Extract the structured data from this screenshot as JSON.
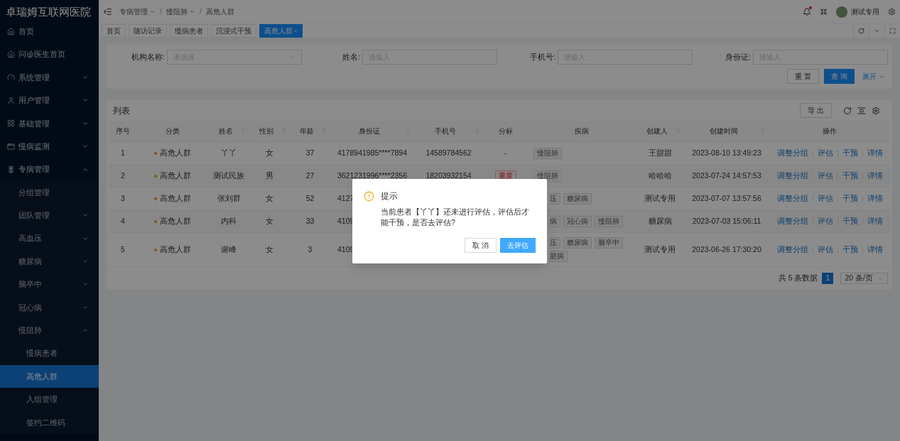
{
  "sidebar": {
    "title": "卓瑞姆互联网医院",
    "items": [
      {
        "label": "首页",
        "selected": false
      },
      {
        "label": "问诊医生首页",
        "selected": false
      },
      {
        "label": "系统管理",
        "selected": false,
        "expanded": false
      },
      {
        "label": "用户管理",
        "selected": false,
        "expanded": false
      },
      {
        "label": "基础管理",
        "selected": false,
        "expanded": false
      },
      {
        "label": "慢病监测",
        "selected": false,
        "expanded": false
      },
      {
        "label": "专病管理",
        "selected": false,
        "expanded": true,
        "children": [
          {
            "label": "分组管理",
            "selected": false
          },
          {
            "label": "团队管理",
            "selected": false,
            "expanded": false
          },
          {
            "label": "高血压",
            "selected": false,
            "expanded": false
          },
          {
            "label": "糖尿病",
            "selected": false,
            "expanded": false
          },
          {
            "label": "脑卒中",
            "selected": false,
            "expanded": false
          },
          {
            "label": "冠心病",
            "selected": false,
            "expanded": false
          },
          {
            "label": "慢阻肺",
            "selected": false,
            "expanded": true,
            "children": [
              {
                "label": "慢病患者",
                "selected": false
              },
              {
                "label": "高危人群",
                "selected": true
              },
              {
                "label": "入组管理",
                "selected": false
              },
              {
                "label": "签约二维码",
                "selected": false
              }
            ]
          }
        ]
      }
    ]
  },
  "header": {
    "breadcrumbs": [
      {
        "label": "专病管理",
        "dropdown": true
      },
      {
        "label": "慢阻肺",
        "dropdown": true
      },
      {
        "label": "高危人群",
        "dropdown": false
      }
    ],
    "separator": "/",
    "notification_dot": true,
    "user": "测试专用"
  },
  "tabs": [
    {
      "label": "首页",
      "selected": false,
      "closable": false
    },
    {
      "label": "随访记录",
      "selected": false,
      "closable": false
    },
    {
      "label": "慢病患者",
      "selected": false,
      "closable": false
    },
    {
      "label": "沉浸式干预",
      "selected": false,
      "closable": false
    },
    {
      "label": "高危人群",
      "selected": true,
      "closable": true
    }
  ],
  "filter": {
    "fields": [
      {
        "label": "机构名称:",
        "placeholder": "请选择",
        "kind": "select"
      },
      {
        "label": "姓名:",
        "placeholder": "请输入",
        "kind": "input"
      },
      {
        "label": "手机号:",
        "placeholder": "请输入",
        "kind": "input"
      },
      {
        "label": "身份证:",
        "placeholder": "请输入",
        "kind": "input"
      }
    ],
    "reset": "重 置",
    "search": "查 询",
    "expand": "展开"
  },
  "list": {
    "title": "列表",
    "export": "导 出",
    "columns": [
      {
        "label": "序号",
        "sortable": false
      },
      {
        "label": "分类",
        "sortable": false
      },
      {
        "label": "姓名",
        "sortable": true
      },
      {
        "label": "性别",
        "sortable": true
      },
      {
        "label": "年龄",
        "sortable": true
      },
      {
        "label": "身份证",
        "sortable": true
      },
      {
        "label": "手机号",
        "sortable": true
      },
      {
        "label": "分标",
        "sortable": false
      },
      {
        "label": "疾病",
        "sortable": false
      },
      {
        "label": "创建人",
        "sortable": true
      },
      {
        "label": "创建时间",
        "sortable": true
      },
      {
        "label": "操作",
        "sortable": false
      }
    ],
    "rows": [
      {
        "index": "1",
        "category": "高危人群",
        "name": "丫丫",
        "gender": "女",
        "age": "37",
        "covered": false,
        "id_number": "4178941985****7894",
        "phone": "14589784562",
        "grade": {
          "text": "-",
          "kind": "plain"
        },
        "diseases": [
          [
            {
              "text": "慢阻肺",
              "partial": false
            }
          ]
        ],
        "creator": "王甜甜",
        "created_at": "2023-08-10 13:49:23",
        "actions": [
          "调整分组",
          "评估",
          "干预",
          "详情"
        ]
      },
      {
        "index": "2",
        "category": "高危人群",
        "name": "测试民族",
        "gender": "男",
        "age": "27",
        "covered": false,
        "id_number": "3621231996****2356",
        "phone": "18203932154",
        "grade": {
          "text": "重度",
          "kind": "tag"
        },
        "diseases": [
          [
            {
              "text": "慢阻肺",
              "partial": false
            }
          ]
        ],
        "creator": "哈哈哈",
        "created_at": "2023-07-24 14:57:53",
        "actions": [
          "调整分组",
          "评估",
          "干预",
          "详情"
        ]
      },
      {
        "index": "3",
        "category": "高危人群",
        "name": "张刘群",
        "gender": "女",
        "age": "52",
        "covered": true,
        "id_number": "4127",
        "diseases": [
          [
            {
              "text": "压",
              "partial": true
            },
            {
              "text": "糖尿病",
              "partial": false
            }
          ]
        ],
        "creator": "测试专用",
        "created_at": "2023-07-07 13:57:56",
        "actions": [
          "调整分组",
          "评估",
          "干预",
          "详情"
        ]
      },
      {
        "index": "4",
        "category": "高危人群",
        "name": "内科",
        "gender": "女",
        "age": "33",
        "covered": true,
        "id_number": "4109",
        "diseases": [
          [
            {
              "text": "病",
              "partial": true
            },
            {
              "text": "冠心病",
              "partial": false
            },
            {
              "text": "慢阻肺",
              "partial": false
            }
          ]
        ],
        "creator": "糖尿病",
        "created_at": "2023-07-03 15:06:11",
        "actions": [
          "调整分组",
          "评估",
          "干预",
          "详情"
        ]
      },
      {
        "index": "5",
        "category": "高危人群",
        "name": "谢峰",
        "gender": "女",
        "age": "3",
        "covered": true,
        "id_number": "4109",
        "diseases": [
          [
            {
              "text": "压",
              "partial": true
            },
            {
              "text": "糖尿病",
              "partial": false
            },
            {
              "text": "脑卒中",
              "partial": false
            }
          ],
          [
            {
              "text": "脏病",
              "partial": true
            }
          ]
        ],
        "creator": "测试专用",
        "created_at": "2023-06-26 17:30:20",
        "actions": [
          "调整分组",
          "评估",
          "干预",
          "详情"
        ]
      }
    ],
    "pagination": {
      "total": "共 5 条数据",
      "pages": [
        {
          "label": "1",
          "selected": true
        }
      ],
      "page_size": "20 条/页"
    }
  },
  "dialog": {
    "title": "提示",
    "message": "当前患者【丫丫】还未进行评估，评估后才能干预，是否去评估?",
    "cancel": "取 消",
    "confirm": "去评估"
  }
}
